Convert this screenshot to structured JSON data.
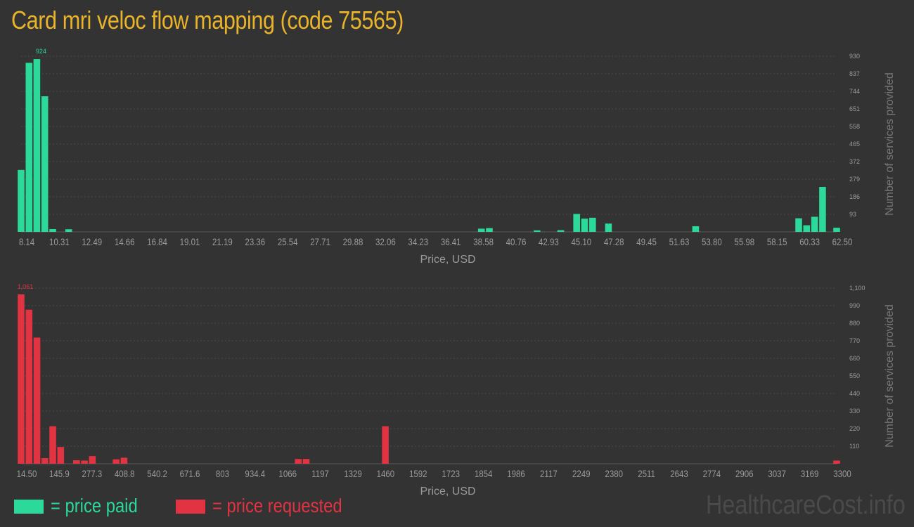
{
  "title": "Card mri veloc flow mapping (code 75565)",
  "chart_data": [
    {
      "type": "bar",
      "series_name": "price paid",
      "color": "#2bd99a",
      "xlabel": "Price, USD",
      "ylabel": "Number of services provided",
      "x_ticks": [
        "8.14",
        "10.31",
        "12.49",
        "14.66",
        "16.84",
        "19.01",
        "21.19",
        "23.36",
        "25.54",
        "27.71",
        "29.88",
        "32.06",
        "34.23",
        "36.41",
        "38.58",
        "40.76",
        "42.93",
        "45.10",
        "47.28",
        "49.45",
        "51.63",
        "53.80",
        "55.98",
        "58.15",
        "60.33",
        "62.50"
      ],
      "y_ticks": [
        "93",
        "186",
        "279",
        "372",
        "465",
        "558",
        "651",
        "744",
        "837",
        "930"
      ],
      "ylim": [
        0,
        930
      ],
      "max_label": "924",
      "bins": 103,
      "x": [
        8.14,
        8.67,
        9.19,
        9.72,
        10.25,
        11.31,
        38.82,
        39.35,
        42.53,
        44.11,
        45.17,
        45.7,
        46.23,
        47.29,
        53.1,
        59.97,
        60.5,
        61.03,
        61.56,
        62.5
      ],
      "values": [
        328,
        895,
        915,
        718,
        15,
        14,
        17,
        20,
        8,
        9,
        95,
        70,
        75,
        44,
        30,
        72,
        35,
        80,
        238,
        22
      ]
    },
    {
      "type": "bar",
      "series_name": "price requested",
      "color": "#e23342",
      "xlabel": "Price, USD",
      "ylabel": "Number of services provided",
      "x_ticks": [
        "14.50",
        "145.9",
        "277.3",
        "408.8",
        "540.2",
        "671.6",
        "803",
        "934.4",
        "1066",
        "1197",
        "1329",
        "1460",
        "1592",
        "1723",
        "1854",
        "1986",
        "2117",
        "2249",
        "2380",
        "2511",
        "2643",
        "2774",
        "2906",
        "3037",
        "3169",
        "3300"
      ],
      "y_ticks": [
        "110",
        "220",
        "330",
        "440",
        "550",
        "660",
        "770",
        "880",
        "990",
        "1,100"
      ],
      "ylim": [
        0,
        1100
      ],
      "max_label": "1,061",
      "bins": 103,
      "x": [
        14.5,
        46.4,
        78.3,
        110.2,
        142.1,
        174.0,
        237.8,
        269.7,
        301.6,
        397.3,
        429.2,
        1131.0,
        1162.9,
        1481.9,
        3300
      ],
      "values": [
        1061,
        965,
        790,
        35,
        235,
        105,
        22,
        20,
        48,
        28,
        38,
        30,
        30,
        235,
        20
      ]
    }
  ],
  "legend": {
    "paid_label": "= price paid",
    "requested_label": "= price requested",
    "paid_color": "#2bd99a",
    "requested_color": "#e23342"
  },
  "watermark": "HealthcareCost.info"
}
